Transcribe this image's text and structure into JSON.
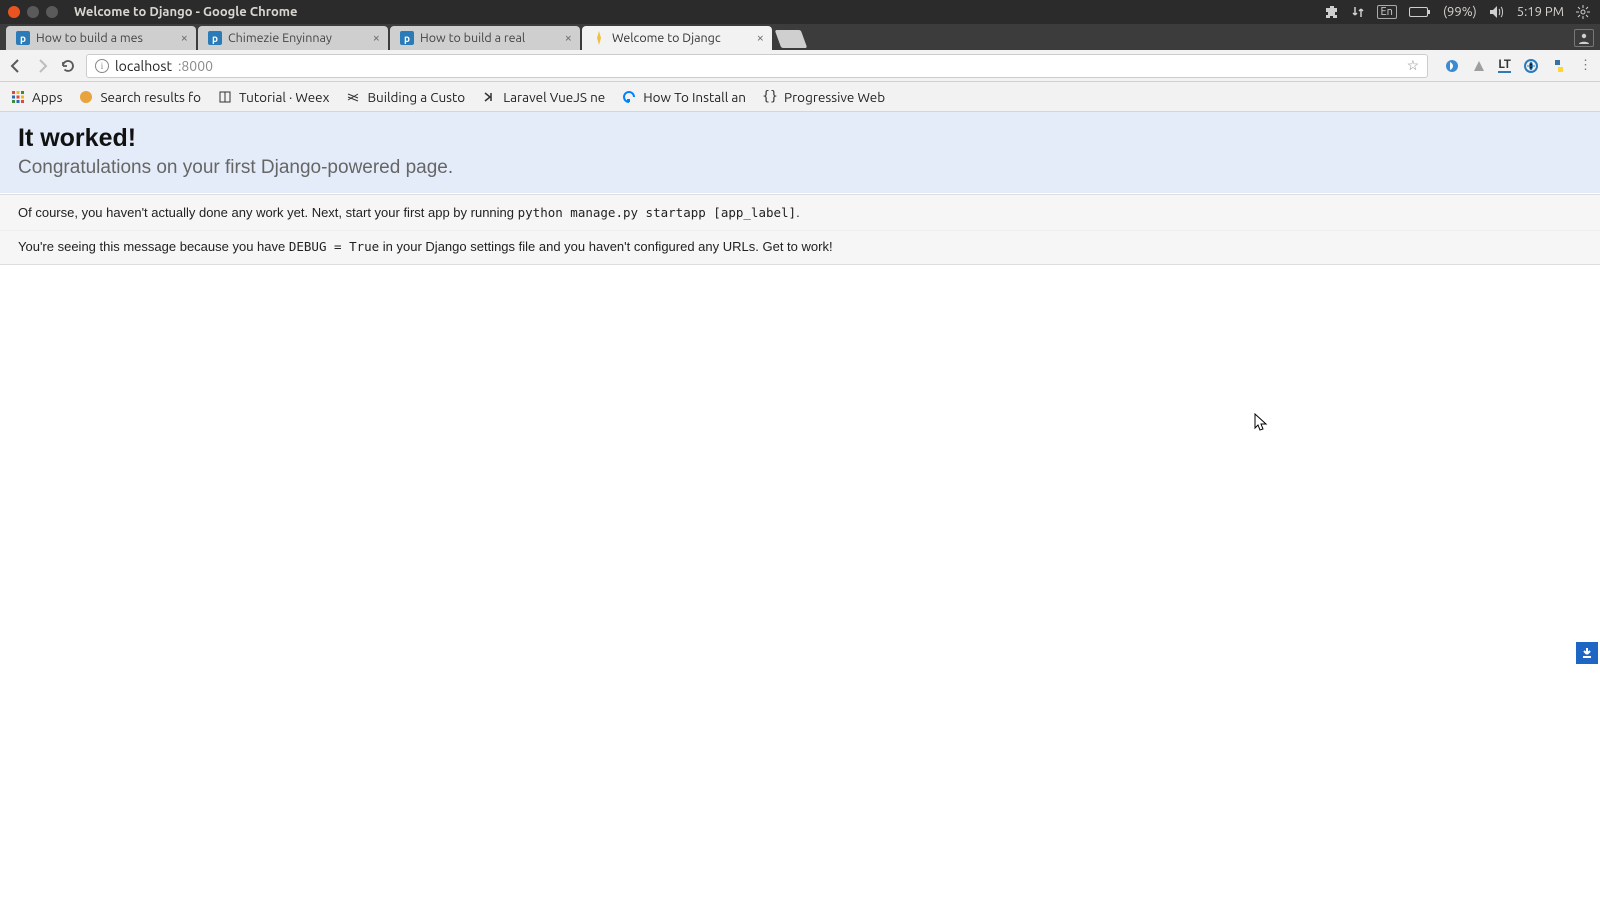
{
  "ubuntu": {
    "window_title": "Welcome to Django - Google Chrome",
    "lang": "En",
    "battery": "(99%)",
    "time": "5:19 PM"
  },
  "tabs": [
    {
      "title": "How to build a mes",
      "active": false,
      "favicon": "p"
    },
    {
      "title": "Chimezie Enyinnay",
      "active": false,
      "favicon": "p"
    },
    {
      "title": "How to build a real",
      "active": false,
      "favicon": "p"
    },
    {
      "title": "Welcome to Djangc",
      "active": true,
      "favicon": "bolt"
    }
  ],
  "omnibox": {
    "host": "localhost",
    "port": ":8000"
  },
  "bookmarks": {
    "apps": "Apps",
    "items": [
      {
        "label": "Search results fo",
        "icon": "coin"
      },
      {
        "label": "Tutorial · Weex",
        "icon": "book"
      },
      {
        "label": "Building a Custo",
        "icon": "lines"
      },
      {
        "label": "Laravel VueJS ne",
        "icon": "chevr"
      },
      {
        "label": "How To Install an",
        "icon": "do"
      },
      {
        "label": "Progressive Web",
        "icon": "braces"
      }
    ]
  },
  "page": {
    "h1": "It worked!",
    "subtitle": "Congratulations on your first Django-powered page.",
    "inst_pre": "Of course, you haven't actually done any work yet. Next, start your first app by running ",
    "inst_code": "python manage.py startapp [app_label]",
    "inst_post": ".",
    "expl_pre": "You're seeing this message because you have ",
    "expl_code": "DEBUG = True",
    "expl_post": " in your Django settings file and you haven't configured any URLs. Get to work!"
  }
}
